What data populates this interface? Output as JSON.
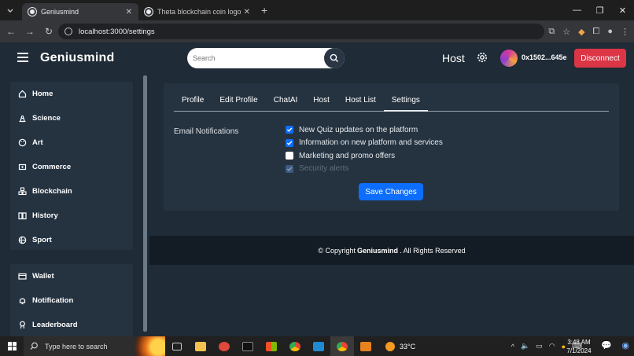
{
  "browser": {
    "tabs": [
      {
        "title": "Geniusmind",
        "active": true
      },
      {
        "title": "Theta blockchain coin logo - Go",
        "active": false
      }
    ],
    "url": "localhost:3000/settings"
  },
  "header": {
    "logo": "Geniusmind",
    "search_placeholder": "Search",
    "host_label": "Host",
    "wallet_address": "0x1502...645e",
    "disconnect_label": "Disconnect"
  },
  "sidebar": {
    "top_items": [
      {
        "label": "Home",
        "icon": "home-icon"
      },
      {
        "label": "Science",
        "icon": "science-icon"
      },
      {
        "label": "Art",
        "icon": "palette-icon"
      },
      {
        "label": "Commerce",
        "icon": "commerce-icon"
      },
      {
        "label": "Blockchain",
        "icon": "blockchain-icon"
      },
      {
        "label": "History",
        "icon": "book-icon"
      },
      {
        "label": "Sport",
        "icon": "ball-icon"
      }
    ],
    "bottom_items": [
      {
        "label": "Wallet",
        "icon": "wallet-icon"
      },
      {
        "label": "Notification",
        "icon": "bell-icon"
      },
      {
        "label": "Leaderboard",
        "icon": "trophy-icon"
      }
    ]
  },
  "settings": {
    "tabs": [
      "Profile",
      "Edit Profile",
      "ChatAI",
      "Host",
      "Host List",
      "Settings"
    ],
    "active_tab": "Settings",
    "email_label": "Email Notifications",
    "options": [
      {
        "label": "New Quiz updates on the platform",
        "checked": true,
        "disabled": false
      },
      {
        "label": "Information on new platform and services",
        "checked": true,
        "disabled": false
      },
      {
        "label": "Marketing and promo offers",
        "checked": false,
        "disabled": false
      },
      {
        "label": "Security alerts",
        "checked": true,
        "disabled": true
      }
    ],
    "save_label": "Save Changes"
  },
  "footer": {
    "prefix": "© Copyright",
    "brand": "Geniusmind",
    "suffix": ". All Rights Reserved"
  },
  "taskbar": {
    "search_placeholder": "Type here to search",
    "temperature": "33°C",
    "time": "3:48 AM",
    "date": "7/1/2024"
  },
  "colors": {
    "background": "#1f2b36",
    "panel": "#253341",
    "primary": "#0d6efd",
    "danger": "#dc3545"
  }
}
